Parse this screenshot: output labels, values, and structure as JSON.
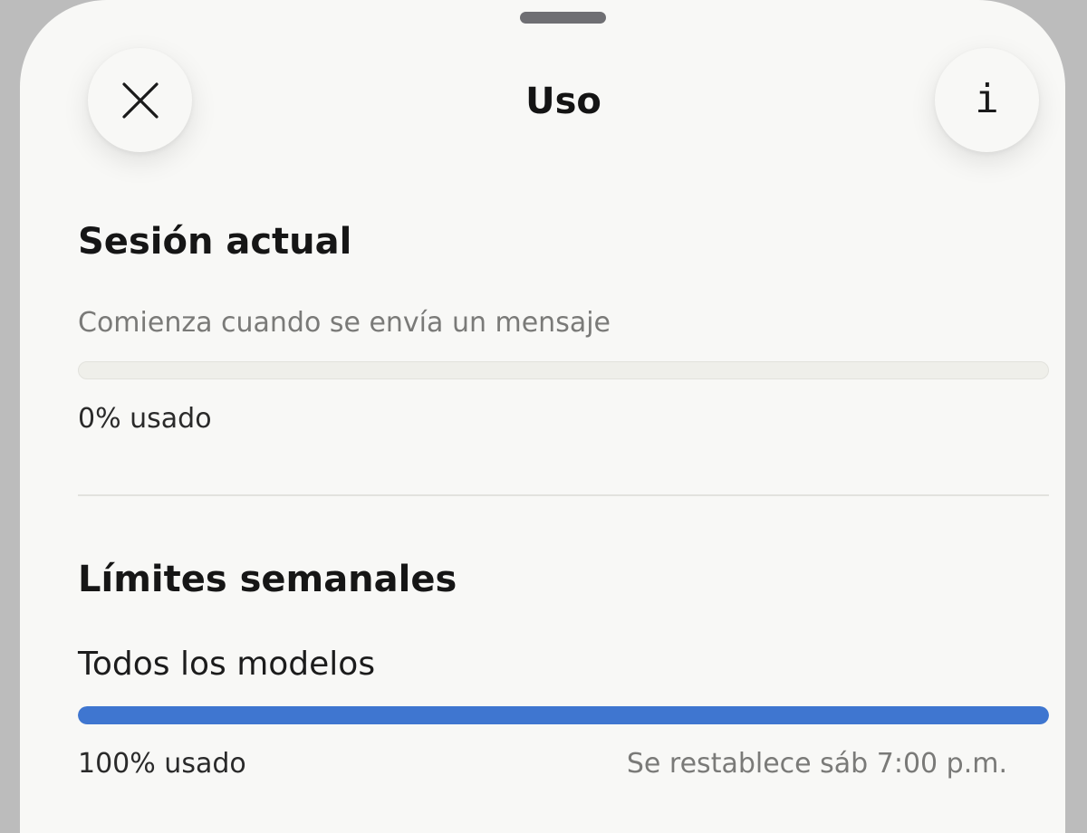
{
  "header": {
    "title": "Uso",
    "close_icon": "close-icon",
    "info_icon": "info-icon",
    "info_glyph": "i"
  },
  "session": {
    "heading": "Sesión actual",
    "description": "Comienza cuando se envía un mensaje",
    "progress": 0,
    "usage_label": "0% usado"
  },
  "weekly": {
    "heading": "Límites semanales",
    "all_models": {
      "label": "Todos los modelos",
      "progress": 1.0,
      "usage_label": "100% usado",
      "reset_label": "Se restablece sáb 7:00 p.m."
    }
  },
  "colors": {
    "accent": "#3f76d0",
    "sheet_background": "#f8f8f6",
    "track": "#efefea"
  }
}
